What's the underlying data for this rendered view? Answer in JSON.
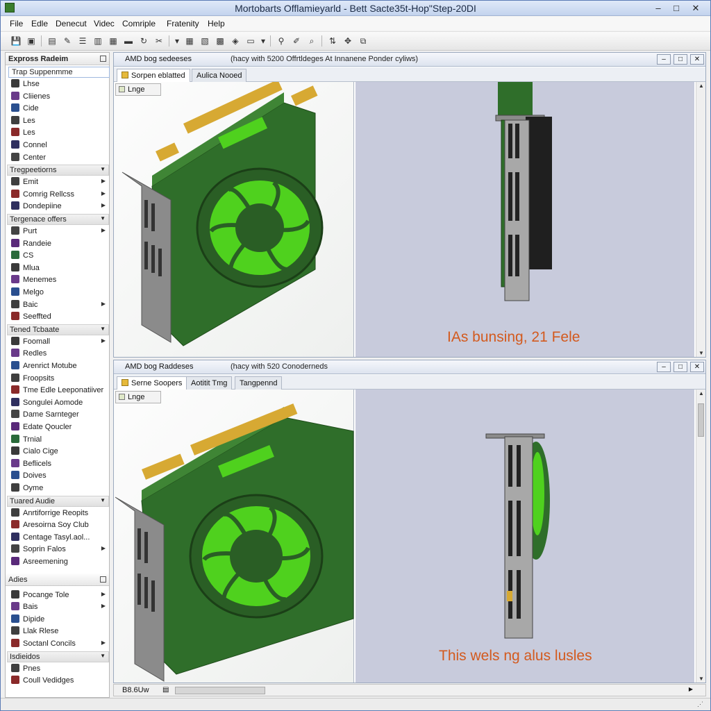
{
  "window": {
    "title": "Mortobarts Offlamieyarld - Bett Sacte35t-Hop\"Step-20DI",
    "accent": "#3a7d2c"
  },
  "menu": [
    "File",
    "Edle",
    "Denecut",
    "Videc",
    "Comriple",
    "Fratenity",
    "Help"
  ],
  "toolbar": {
    "icons": [
      "save-icon",
      "folder-icon",
      "open-icon",
      "pen-icon",
      "list-icon",
      "layout-icon",
      "grid-icon",
      "bar-icon",
      "refresh-icon",
      "cut-icon",
      "dropdown-icon",
      "table-icon",
      "group-icon",
      "pattern-icon",
      "tag-icon",
      "monitor-icon",
      "dropdown-icon",
      "search-icon",
      "pencil-icon",
      "find-icon",
      "sort-icon",
      "move-icon",
      "connect-icon"
    ]
  },
  "sidebar": {
    "header": "Expross Radeim",
    "groups": [
      {
        "title": "Trap Suppenmme",
        "selected": true,
        "items": [
          {
            "label": "Lhse"
          },
          {
            "label": "Cliienes"
          },
          {
            "label": "Cide"
          },
          {
            "label": "Les"
          },
          {
            "label": "Les"
          },
          {
            "label": "Connel"
          },
          {
            "label": "Center"
          }
        ]
      },
      {
        "title": "Tregpeetiorns",
        "items": [
          {
            "label": "Emit",
            "sub": true
          },
          {
            "label": "Comrig Rellcss",
            "sub": true
          },
          {
            "label": "Dondepiine",
            "sub": true
          }
        ]
      },
      {
        "title": "Tergenace offers",
        "items": [
          {
            "label": "Purt",
            "sub": true
          },
          {
            "label": "Randeie"
          },
          {
            "label": "CS"
          },
          {
            "label": "Mlua"
          },
          {
            "label": "Menemes"
          },
          {
            "label": "Melgo"
          },
          {
            "label": "Baic",
            "sub": true
          },
          {
            "label": "Seeffted"
          }
        ]
      },
      {
        "title": "Tened Tcbaate",
        "items": [
          {
            "label": "Foomall",
            "sub": true
          },
          {
            "label": "Redles"
          },
          {
            "label": "Arenrict Motube"
          },
          {
            "label": "Froopsits"
          },
          {
            "label": "Tme Edle Leeponatiiver"
          },
          {
            "label": "Songulei Aomode"
          },
          {
            "label": "Dame Sarnteger"
          },
          {
            "label": "Edate Qoucler"
          },
          {
            "label": "Trnial"
          },
          {
            "label": "Cialo Cige"
          },
          {
            "label": "Beflicels"
          },
          {
            "label": "Doives"
          },
          {
            "label": "Oyme"
          }
        ]
      },
      {
        "title": "Tuared Audie",
        "items": [
          {
            "label": "Anrtiforrige Reopits"
          },
          {
            "label": "Aresoirna Soy Club"
          },
          {
            "label": "Centage Tasyl.aol..."
          },
          {
            "label": "Soprin Falos",
            "sub": true
          },
          {
            "label": "Asreemening"
          }
        ]
      }
    ],
    "header2": "Adies",
    "groups2": [
      {
        "title": null,
        "items": [
          {
            "label": "Pocange Tole",
            "sub": true
          },
          {
            "label": "Bais",
            "sub": true
          },
          {
            "label": "Dipide"
          },
          {
            "label": "Llak Rlese"
          },
          {
            "label": "Soctanl Concils",
            "sub": true
          }
        ]
      },
      {
        "title": "Isdieidos",
        "items": [
          {
            "label": "Pnes"
          },
          {
            "label": "Coull Vedidges"
          }
        ]
      }
    ]
  },
  "panes": [
    {
      "title": "AMD bog sedeeses",
      "subtitle": "(hacy with 5200 Offrtldeges At Innanene Ponder cyliws)",
      "tabs": [
        "Sorpen eblatted",
        "Aulica Nooed"
      ],
      "chip": "Lnge",
      "caption": "IAs bunsing, 21 Fele"
    },
    {
      "title": "AMD bog Raddeses",
      "subtitle": "(hacy with 520 Conoderneds",
      "tabs": [
        "Serne Soopers",
        "Aotitit Tmg",
        "Tangpennd"
      ],
      "chip": "Lnge",
      "caption": "This wels ng alus lusles"
    }
  ],
  "status": {
    "zoom": "B8.6Uw"
  },
  "colors": {
    "pcb": "#2f6e2a",
    "fan": "#4fd11e",
    "gold": "#d7a933",
    "bracket": "#8b8b8b",
    "caption": "#d35a1e"
  }
}
